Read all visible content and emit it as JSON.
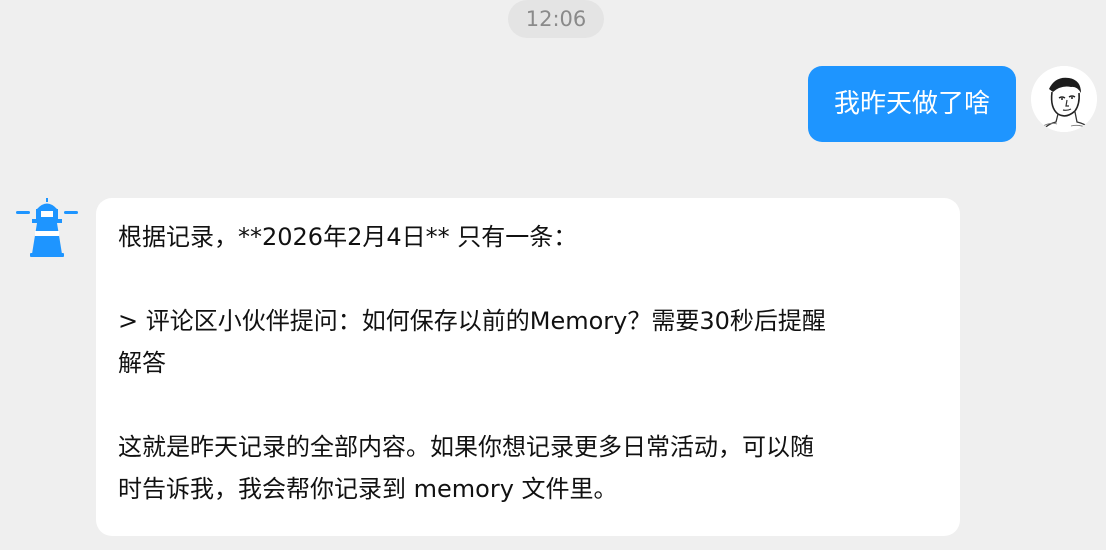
{
  "timestamp": "12:06",
  "user_message": {
    "text": "我昨天做了啥"
  },
  "bot_message": {
    "lines": [
      "根据记录，**2026年2月4日** 只有一条：",
      "> 评论区小伙伴提问：如何保存以前的Memory？需要30秒后提醒",
      "解答",
      "这就是昨天记录的全部内容。如果你想记录更多日常活动，可以随",
      "时告诉我，我会帮你记录到 memory 文件里。"
    ]
  },
  "colors": {
    "background": "#efefef",
    "user_bubble": "#1e95ff",
    "bot_bubble": "#ffffff",
    "bot_icon_blue": "#1e95ff"
  },
  "icons": {
    "bot_avatar": "lighthouse-icon",
    "user_avatar": "sketch-portrait-icon"
  }
}
